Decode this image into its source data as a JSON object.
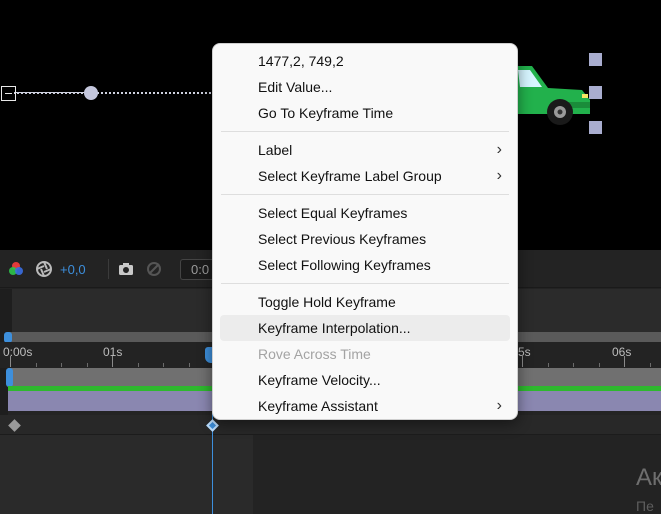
{
  "colors": {
    "accent": "#3d8fdc",
    "menu_bg": "#f9f9f9",
    "menu_hover": "#ececec",
    "disabled_text": "#a3a3a3",
    "layer_bar": "#8a87b0",
    "green_line": "#2eb82e",
    "car_body": "#22b14c"
  },
  "viewer": {
    "icons": [
      "anchor-point-icon",
      "motion-path-knob-icon",
      "car-icon",
      "bounding-handle-icon"
    ]
  },
  "toolbar": {
    "rgb_icon": "rgb-channels-icon",
    "aperture_icon": "exposure-icon",
    "exposure_value": "+0,0",
    "camera_icon": "snapshot-camera-icon",
    "show_snapshot_icon": "show-snapshot-icon",
    "timecode": "0:0"
  },
  "ruler": {
    "labels": [
      "0:00s",
      "01s",
      "5s",
      "06s"
    ]
  },
  "context_menu": {
    "groups": [
      [
        {
          "label": "1477,2, 749,2",
          "submenu": false,
          "disabled": false
        },
        {
          "label": "Edit Value...",
          "submenu": false,
          "disabled": false
        },
        {
          "label": "Go To Keyframe Time",
          "submenu": false,
          "disabled": false
        }
      ],
      [
        {
          "label": "Label",
          "submenu": true,
          "disabled": false
        },
        {
          "label": "Select Keyframe Label Group",
          "submenu": true,
          "disabled": false
        }
      ],
      [
        {
          "label": "Select Equal Keyframes",
          "submenu": false,
          "disabled": false
        },
        {
          "label": "Select Previous Keyframes",
          "submenu": false,
          "disabled": false
        },
        {
          "label": "Select Following Keyframes",
          "submenu": false,
          "disabled": false
        }
      ],
      [
        {
          "label": "Toggle Hold Keyframe",
          "submenu": false,
          "disabled": false
        },
        {
          "label": "Keyframe Interpolation...",
          "submenu": false,
          "disabled": false,
          "hovered": true
        },
        {
          "label": "Rove Across Time",
          "submenu": false,
          "disabled": true
        },
        {
          "label": "Keyframe Velocity...",
          "submenu": false,
          "disabled": false
        },
        {
          "label": "Keyframe Assistant",
          "submenu": true,
          "disabled": false
        }
      ]
    ],
    "submenu_glyph": "›"
  },
  "watermark": {
    "title": "Ак",
    "subtitle": "Пе"
  }
}
